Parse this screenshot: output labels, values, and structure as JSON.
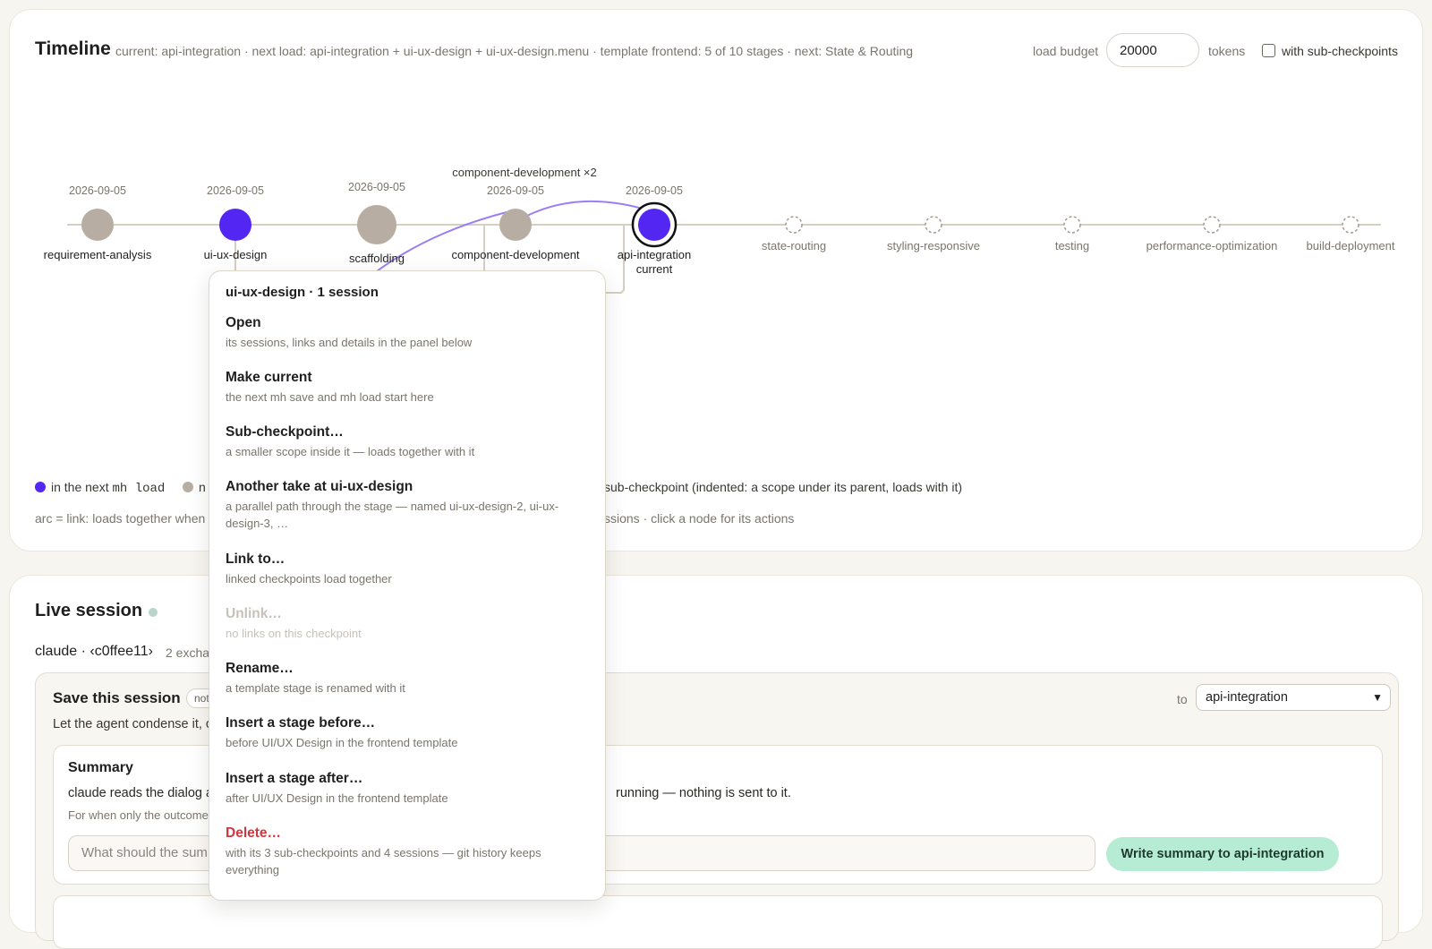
{
  "colors": {
    "current_load": "#5326f2",
    "not_in_load": "#b7ada2",
    "future": "#a29a90",
    "link_arc": "#9b7ef3",
    "danger": "#d2363f",
    "accent_button": "#b6ecd3"
  },
  "timeline": {
    "title": "Timeline",
    "status": "current: api-integration · next load: api-integration + ui-ux-design + ui-ux-design.menu · template frontend: 5 of 10 stages · next: State & Routing",
    "budget_label": "load budget",
    "budget_value": "20000",
    "tokens_label": "tokens",
    "subcheckpoints_label": "with sub-checkpoints",
    "subcheckpoints_checked": false,
    "group_label": "component-development ×2",
    "nodes": [
      {
        "name": "requirement-analysis",
        "date": "2026-09-05",
        "state": "not-in-load"
      },
      {
        "name": "ui-ux-design",
        "date": "2026-09-05",
        "state": "in-load"
      },
      {
        "name": "scaffolding",
        "date": "2026-09-05",
        "state": "not-in-load"
      },
      {
        "name": "component-development",
        "date": "2026-09-05",
        "state": "not-in-load"
      },
      {
        "name": "api-integration",
        "date": "2026-09-05",
        "state": "current",
        "sublabel": "current"
      },
      {
        "name": "state-routing",
        "date": "",
        "state": "future"
      },
      {
        "name": "styling-responsive",
        "date": "",
        "state": "future"
      },
      {
        "name": "testing",
        "date": "",
        "state": "future"
      },
      {
        "name": "performance-optimization",
        "date": "",
        "state": "future"
      },
      {
        "name": "build-deployment",
        "date": "",
        "state": "future"
      }
    ],
    "legend": {
      "in_load_text": "in the next",
      "in_load_cmd": "mh load",
      "not_in_load_text": "n",
      "subcheckpoint_text": "sub-checkpoint (indented: a scope under its parent, loads with it)"
    },
    "hint_left": "arc = link: loads together when",
    "hint_right": "ssions · click a node for its actions"
  },
  "live": {
    "title": "Live session",
    "agent": "claude · ‹c0ffee11›",
    "exchanges": "2 excha",
    "save": {
      "title": "Save this session",
      "pill": "not",
      "desc": "Let the agent condense it, c",
      "to_label": "to",
      "target": "api-integration",
      "summary": {
        "title": "Summary",
        "line1": "claude reads the dialog a",
        "line1_rest": "running — nothing is sent to it.",
        "line2": "For when only the outcome",
        "placeholder": "What should the sum",
        "button": "Write summary to api-integration"
      }
    }
  },
  "menu": {
    "header": "ui-ux-design · 1 session",
    "items": [
      {
        "label": "Open",
        "desc": "its sessions, links and details in the panel below"
      },
      {
        "label": "Make current",
        "desc": "the next mh save and mh load start here"
      },
      {
        "label": "Sub-checkpoint…",
        "desc": "a smaller scope inside it — loads together with it"
      },
      {
        "label": "Another take at ui-ux-design",
        "desc": "a parallel path through the stage — named ui-ux-design-2, ui-ux-design-3, …"
      },
      {
        "label": "Link to…",
        "desc": "linked checkpoints load together"
      },
      {
        "label": "Unlink…",
        "desc": "no links on this checkpoint",
        "disabled": true
      },
      {
        "label": "Rename…",
        "desc": "a template stage is renamed with it"
      },
      {
        "label": "Insert a stage before…",
        "desc": "before UI/UX Design in the frontend template"
      },
      {
        "label": "Insert a stage after…",
        "desc": "after UI/UX Design in the frontend template"
      },
      {
        "label": "Delete…",
        "desc": "with its 3 sub-checkpoints and 4 sessions — git history keeps everything",
        "danger": true
      }
    ]
  }
}
